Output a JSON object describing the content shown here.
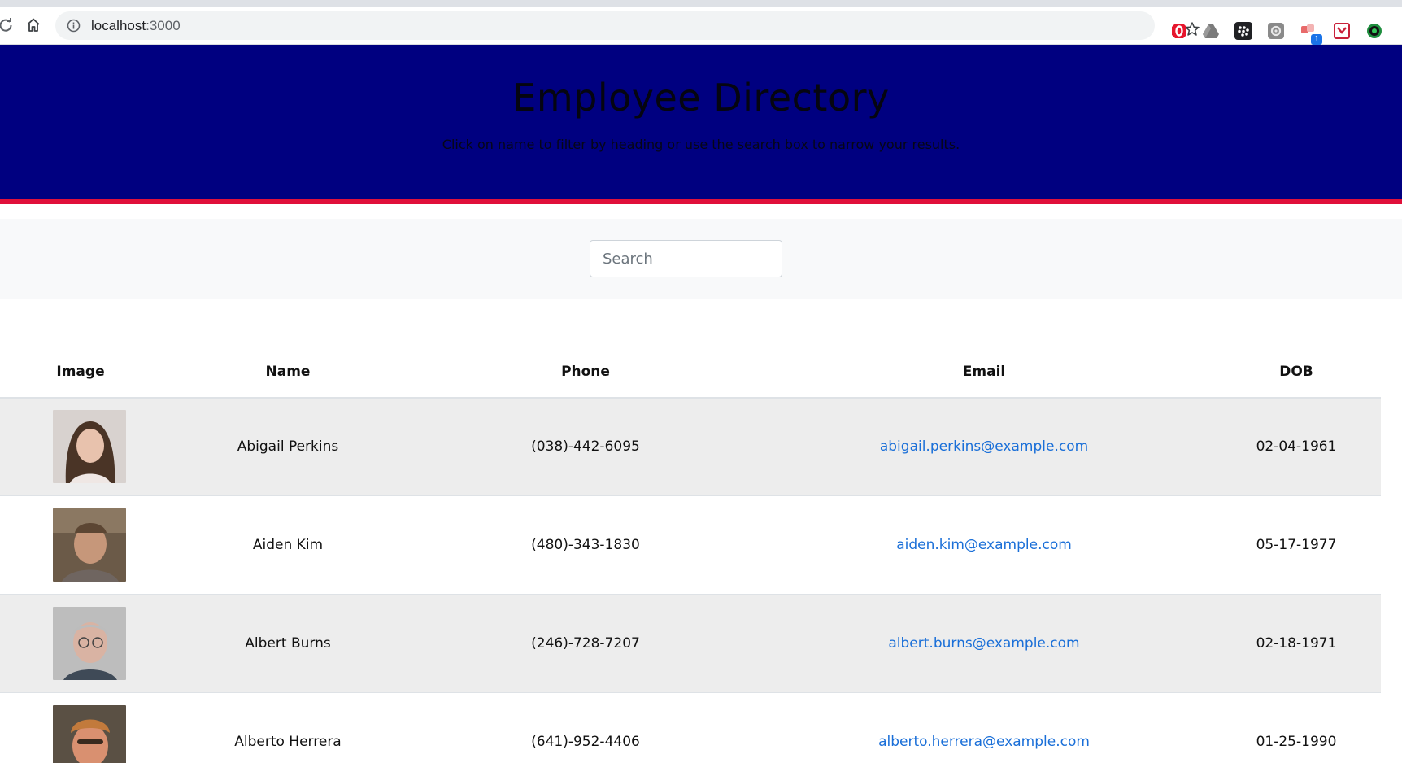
{
  "browser": {
    "url_host": "localhost",
    "url_port": ":3000",
    "extension_badge": "1"
  },
  "header": {
    "title": "Employee Directory",
    "subtitle": "Click on name to filter by heading or use the search box to narrow your results."
  },
  "search": {
    "placeholder": "Search",
    "value": ""
  },
  "table": {
    "columns": [
      "Image",
      "Name",
      "Phone",
      "Email",
      "DOB"
    ],
    "rows": [
      {
        "name": "Abigail Perkins",
        "phone": "(038)-442-6095",
        "email": "abigail.perkins@example.com",
        "dob": "02-04-1961"
      },
      {
        "name": "Aiden Kim",
        "phone": "(480)-343-1830",
        "email": "aiden.kim@example.com",
        "dob": "05-17-1977"
      },
      {
        "name": "Albert Burns",
        "phone": "(246)-728-7207",
        "email": "albert.burns@example.com",
        "dob": "02-18-1971"
      },
      {
        "name": "Alberto Herrera",
        "phone": "(641)-952-4406",
        "email": "alberto.herrera@example.com",
        "dob": "01-25-1990"
      }
    ]
  },
  "colors": {
    "hero_bg": "#000080",
    "hero_border": "#e0103a",
    "link": "#1a6fd8",
    "row_stripe": "#ededed"
  }
}
